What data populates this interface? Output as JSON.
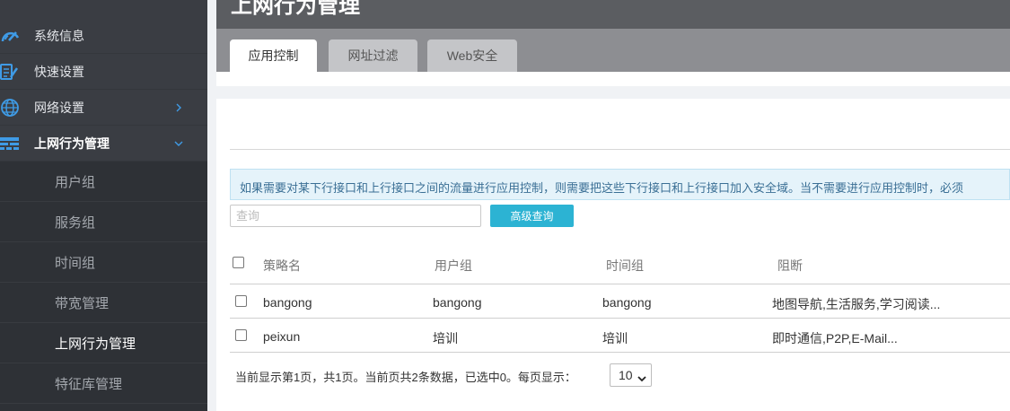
{
  "sidebar": {
    "items": [
      {
        "label": "系统信息",
        "icon": "speedometer-icon"
      },
      {
        "label": "快速设置",
        "icon": "document-edit-icon"
      },
      {
        "label": "网络设置",
        "icon": "globe-icon"
      },
      {
        "label": "上网行为管理",
        "icon": "wall-icon"
      }
    ],
    "submenu": [
      {
        "label": "用户组"
      },
      {
        "label": "服务组"
      },
      {
        "label": "时间组"
      },
      {
        "label": "带宽管理"
      },
      {
        "label": "上网行为管理"
      },
      {
        "label": "特征库管理"
      }
    ]
  },
  "header": {
    "title": "上网行为管理"
  },
  "tabs": [
    {
      "label": "应用控制",
      "active": true
    },
    {
      "label": "网址过滤",
      "active": false
    },
    {
      "label": "Web安全",
      "active": false
    }
  ],
  "notice": "如果需要对某下行接口和上行接口之间的流量进行应用控制，则需要把这些下行接口和上行接口加入安全域。当不需要进行应用控制时，必须",
  "search": {
    "placeholder": "查询",
    "advanced_label": "高级查询"
  },
  "table": {
    "columns": [
      "策略名",
      "用户组",
      "时间组",
      "阻断"
    ],
    "rows": [
      {
        "name": "bangong",
        "user_group": "bangong",
        "time_group": "bangong",
        "block": "地图导航,生活服务,学习阅读..."
      },
      {
        "name": "peixun",
        "user_group": "培训",
        "time_group": "培训",
        "block": "即时通信,P2P,E-Mail..."
      }
    ]
  },
  "pager": {
    "text": "当前显示第1页，共1页。当前页共2条数据，已选中0。每页显示：",
    "page_size": "10"
  },
  "colors": {
    "sidebar_bg": "#3a3d43",
    "submenu_bg": "#2e3136",
    "accent": "#2cb3d3",
    "icon_blue": "#3f9be6",
    "notice_bg": "#e5f3fa"
  }
}
